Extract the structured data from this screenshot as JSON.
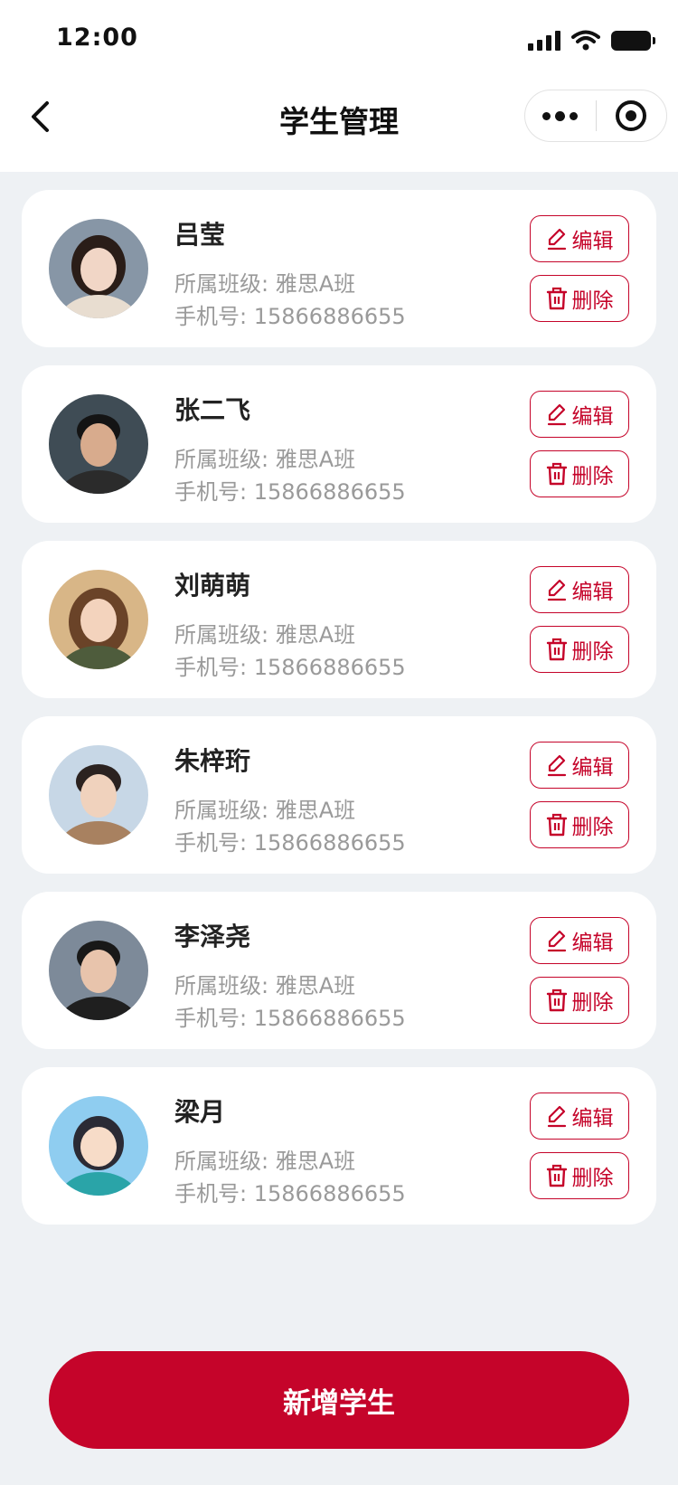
{
  "status_bar": {
    "time": "12:00"
  },
  "nav": {
    "title": "学生管理"
  },
  "labels": {
    "class_prefix": "所属班级: ",
    "phone_prefix": "手机号: ",
    "edit": "编辑",
    "delete": "删除"
  },
  "students": [
    {
      "name": "吕莹",
      "class": "雅思A班",
      "phone": "15866886655",
      "avatar": {
        "bg": "#8796a6",
        "skin": "#f1d6c6",
        "hair": "#2a1d18",
        "cloth": "#e8ddd0"
      }
    },
    {
      "name": "张二飞",
      "class": "雅思A班",
      "phone": "15866886655",
      "avatar": {
        "bg": "#3f4c55",
        "skin": "#d8ab8d",
        "hair": "#141414",
        "cloth": "#2b2b2b"
      }
    },
    {
      "name": "刘萌萌",
      "class": "雅思A班",
      "phone": "15866886655",
      "avatar": {
        "bg": "#d8b687",
        "skin": "#f3d3bd",
        "hair": "#6a4328",
        "cloth": "#4e5c3c"
      }
    },
    {
      "name": "朱梓珩",
      "class": "雅思A班",
      "phone": "15866886655",
      "avatar": {
        "bg": "#c7d7e6",
        "skin": "#f0d2bd",
        "hair": "#2b2220",
        "cloth": "#a88160"
      }
    },
    {
      "name": "李泽尧",
      "class": "雅思A班",
      "phone": "15866886655",
      "avatar": {
        "bg": "#7d8a99",
        "skin": "#e8c4ac",
        "hair": "#181818",
        "cloth": "#1f1f1f"
      }
    },
    {
      "name": "梁月",
      "class": "雅思A班",
      "phone": "15866886655",
      "avatar": {
        "bg": "#8fcdf0",
        "skin": "#f7dcc8",
        "hair": "#2b2b35",
        "cloth": "#2aa4a8"
      }
    }
  ],
  "add_button": {
    "label": "新增学生"
  },
  "colors": {
    "accent": "#c5042a",
    "background": "#eef1f4",
    "card": "#ffffff",
    "secondary_text": "#9a9a9a"
  },
  "icons": {
    "back": "chevron-left-icon",
    "more": "more-dots-icon",
    "close": "record-circle-icon",
    "edit": "pencil-icon",
    "delete": "trash-icon"
  }
}
